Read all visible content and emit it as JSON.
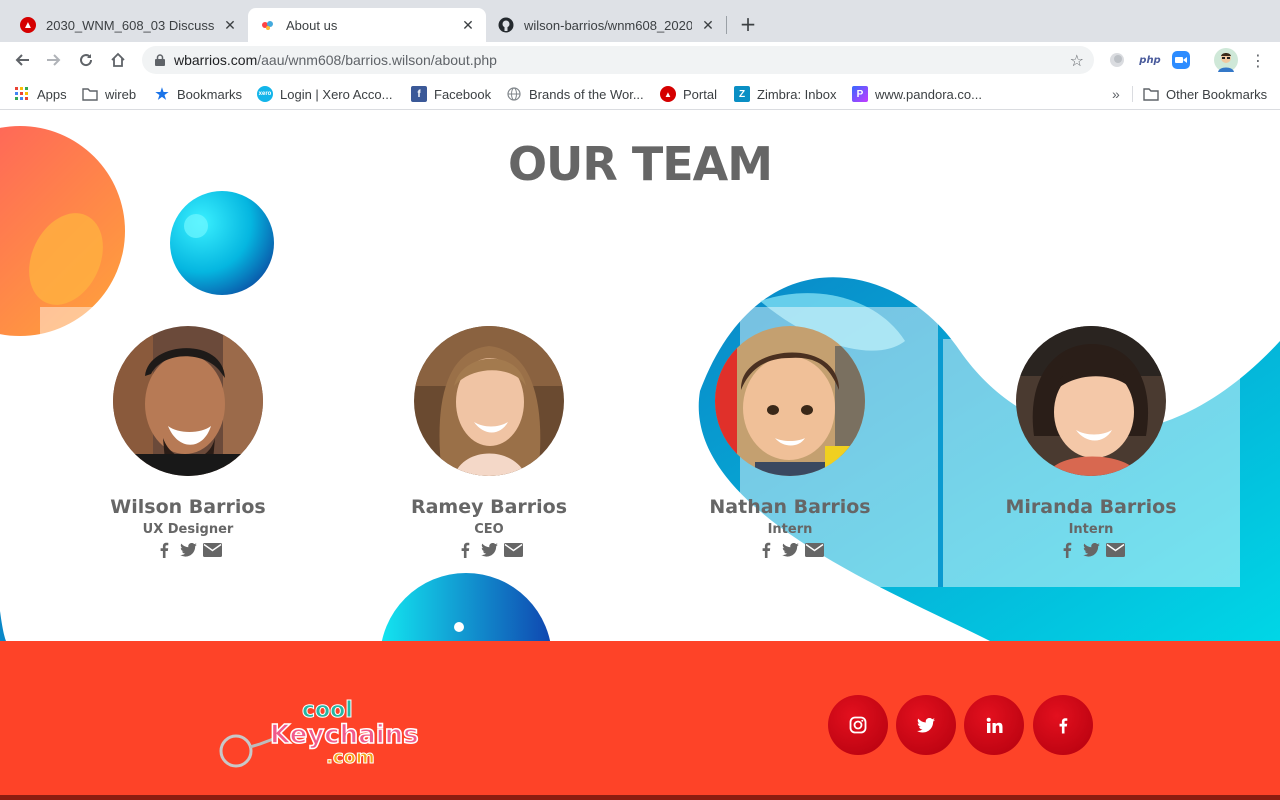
{
  "browser": {
    "tabs": [
      {
        "title": "2030_WNM_608_03 Discussion",
        "active": false
      },
      {
        "title": "About us",
        "active": true
      },
      {
        "title": "wilson-barrios/wnm608_2020",
        "active": false
      }
    ],
    "url_host": "wbarrios.com",
    "url_path": "/aau/wnm608/barrios.wilson/about.php",
    "extensions": {
      "php_label": "php"
    },
    "bookmarks": [
      {
        "label": "Apps",
        "icon": "apps-grid-icon"
      },
      {
        "label": "wireb",
        "icon": "folder-icon"
      },
      {
        "label": "Bookmarks",
        "icon": "star-icon"
      },
      {
        "label": "Login | Xero Acco...",
        "icon": "xero-icon"
      },
      {
        "label": "Facebook",
        "icon": "facebook-icon"
      },
      {
        "label": "Brands of the Wor...",
        "icon": "globe-icon"
      },
      {
        "label": "Portal",
        "icon": "portal-icon"
      },
      {
        "label": "Zimbra: Inbox",
        "icon": "zimbra-icon"
      },
      {
        "label": "www.pandora.co...",
        "icon": "pandora-icon"
      }
    ],
    "overflow_label": "»",
    "other_bookmarks": "Other Bookmarks"
  },
  "page": {
    "heading": "OUR TEAM",
    "members": [
      {
        "name": "Wilson Barrios",
        "role": "UX Designer"
      },
      {
        "name": "Ramey Barrios",
        "role": "CEO"
      },
      {
        "name": "Nathan Barrios",
        "role": "Intern"
      },
      {
        "name": "Miranda Barrios",
        "role": "Intern"
      }
    ]
  },
  "footer": {
    "logo_line1": "cool",
    "logo_line2": "Keychains",
    "logo_line3": ".com",
    "social": [
      "instagram-icon",
      "twitter-icon",
      "linkedin-icon",
      "facebook-icon"
    ]
  },
  "colors": {
    "footer_bg": "#fe4328",
    "social_btn": "#d0061a",
    "heading": "#666666",
    "wave": "#00c8e0"
  }
}
